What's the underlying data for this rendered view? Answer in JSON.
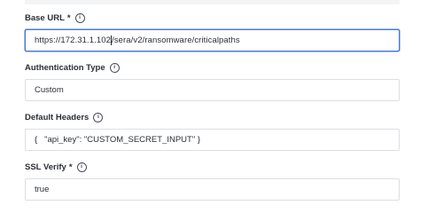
{
  "base_url": {
    "label": "Base URL",
    "required_mark": "*",
    "info_icon": "info-icon",
    "value_before_caret": "https://172.31.1.102",
    "value_after_caret": "/sera/v2/ransomware/criticalpaths"
  },
  "auth_type": {
    "label": "Authentication Type",
    "info_icon": "info-icon",
    "value": "Custom"
  },
  "default_headers": {
    "label": "Default Headers",
    "info_icon": "info-icon",
    "value": "{   \"api_key\": \"CUSTOM_SECRET_INPUT\" }"
  },
  "ssl_verify": {
    "label": "SSL Verify",
    "required_mark": "*",
    "info_icon": "info-icon",
    "value": "true"
  },
  "colors": {
    "focus_border": "#4a78d6",
    "input_border": "#dcdfe4",
    "label_text": "#2b2f36"
  }
}
